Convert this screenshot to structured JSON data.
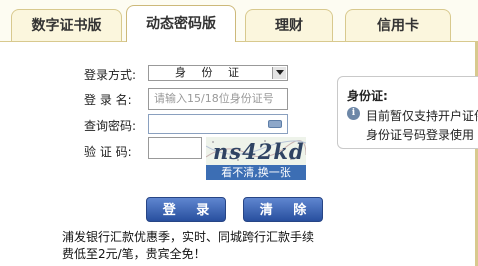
{
  "tabs": [
    {
      "label": "数字证书版",
      "active": false
    },
    {
      "label": "动态密码版",
      "active": true
    },
    {
      "label": "理财",
      "active": false
    },
    {
      "label": "信用卡",
      "active": false
    }
  ],
  "form": {
    "login_type_label": "登录方式:",
    "login_type_value": "身 份 证",
    "login_name_label": "登 录 名:",
    "login_name_placeholder": "请输入15/18位身份证号",
    "query_password_label": "查询密码:",
    "captcha_label": "验 证 码:",
    "captcha_text": "ns42kd",
    "captcha_refresh": "看不清,换一张"
  },
  "buttons": {
    "login": "登 录",
    "clear": "清 除"
  },
  "promo": {
    "line1": "浦发银行汇款优惠季，实时、同城跨行汇款手续",
    "line2": "费低至2元/笔，贵宾全免！"
  },
  "tip": {
    "title": "身份证:",
    "line1": "目前暂仅支持开户证件",
    "line2": "身份证号码登录使用"
  },
  "colors": {
    "accent": "#284f9e",
    "tab_border": "#d8c98e",
    "background": "#fdfcf2"
  }
}
